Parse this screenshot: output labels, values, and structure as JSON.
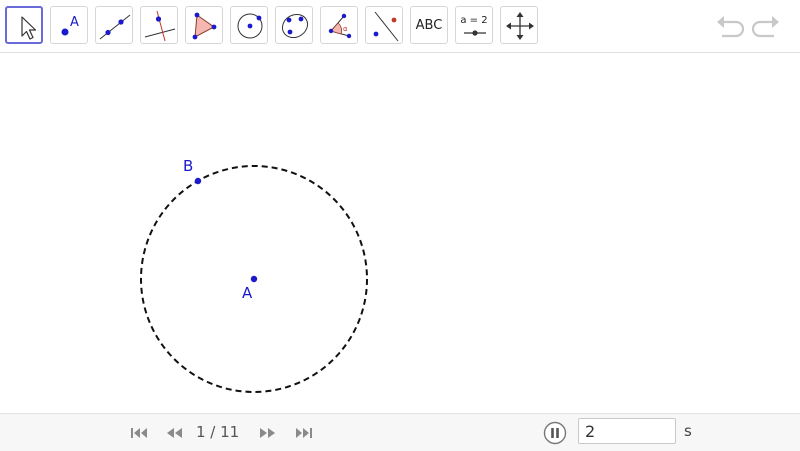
{
  "toolbar": {
    "tools": [
      {
        "name": "move-tool-icon",
        "selected": true
      },
      {
        "name": "point-tool-icon"
      },
      {
        "name": "line-tool-icon"
      },
      {
        "name": "perpendicular-line-tool-icon"
      },
      {
        "name": "polygon-tool-icon"
      },
      {
        "name": "circle-tool-icon"
      },
      {
        "name": "conic-tool-icon"
      },
      {
        "name": "angle-tool-icon"
      },
      {
        "name": "reflect-tool-icon"
      },
      {
        "name": "text-tool-icon",
        "label": "ABC"
      },
      {
        "name": "slider-tool-icon",
        "label": "a = 2"
      },
      {
        "name": "move-graphics-view-tool-icon"
      }
    ],
    "point_tool_letter": "A",
    "undo_icon": "undo-icon",
    "redo_icon": "redo-icon"
  },
  "canvas": {
    "points": [
      {
        "label": "A"
      },
      {
        "label": "B"
      }
    ],
    "circle_style": "dashed",
    "point_color": "#1a1acc"
  },
  "playback": {
    "step_text": "1 / 11",
    "speed_value": "2",
    "speed_unit": "s"
  },
  "colors": {
    "selected_border": "#6a6ad8",
    "point_blue": "#1a1acc",
    "polygon_fill": "#f4b8b0"
  }
}
